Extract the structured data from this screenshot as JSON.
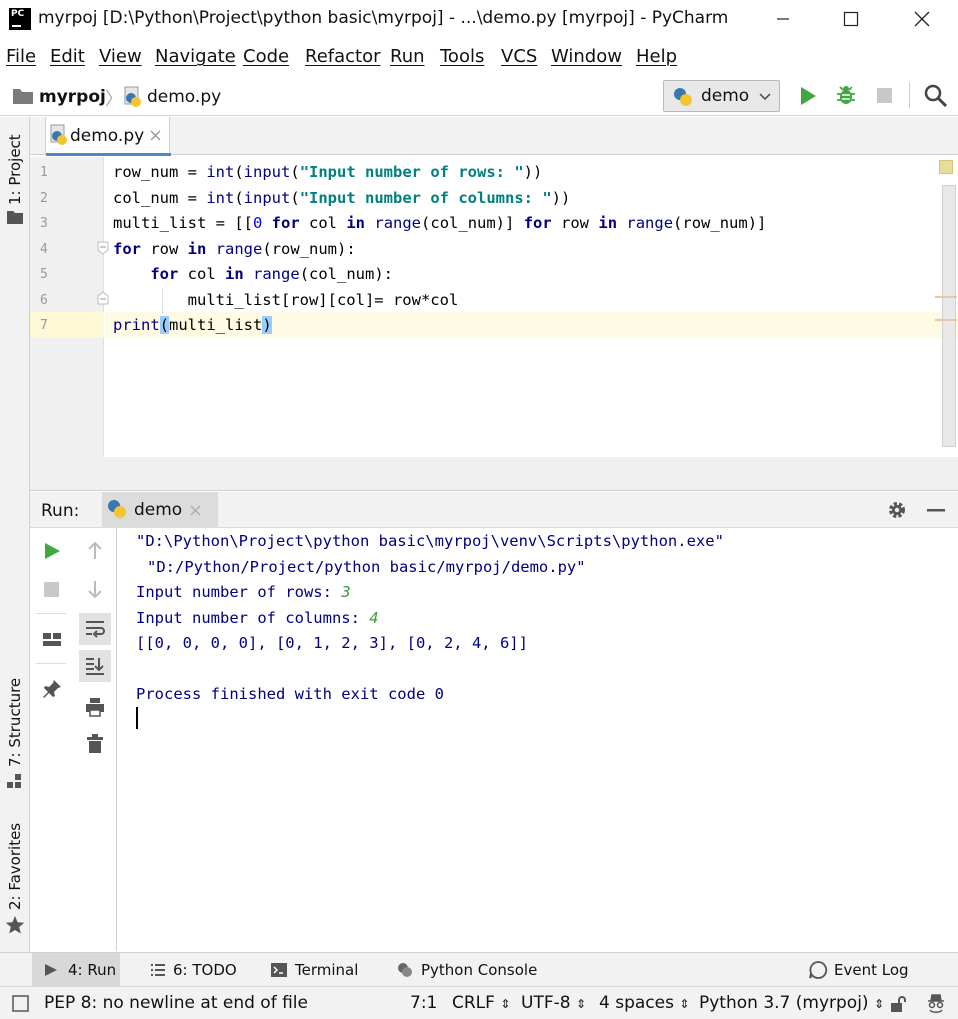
{
  "window": {
    "title": "myrpoj [D:\\Python\\Project\\python basic\\myrpoj] - ...\\demo.py [myrpoj] - PyCharm",
    "app_icon_text": "PC"
  },
  "menu": [
    "File",
    "Edit",
    "View",
    "Navigate",
    "Code",
    "Refactor",
    "Run",
    "Tools",
    "VCS",
    "Window",
    "Help"
  ],
  "navbar": {
    "project": "myrpoj",
    "file": "demo.py",
    "run_config": "demo"
  },
  "editor_tab": {
    "label": "demo.py"
  },
  "side_tools": {
    "project": "1: Project",
    "structure": "7: Structure",
    "favorites": "2: Favorites"
  },
  "editor": {
    "line_numbers": [
      "1",
      "2",
      "3",
      "4",
      "5",
      "6",
      "7"
    ]
  },
  "run_panel": {
    "label": "Run:",
    "tab": "demo",
    "console": {
      "cmd_line1": "\"D:\\Python\\Project\\python basic\\myrpoj\\venv\\Scripts\\python.exe\"",
      "cmd_line2": "\"D:/Python/Project/python basic/myrpoj/demo.py\"",
      "prompt_rows": "Input number of rows: ",
      "rows_value": "3",
      "prompt_cols": "Input number of columns: ",
      "cols_value": "4",
      "result": "[[0, 0, 0, 0], [0, 1, 2, 3], [0, 2, 4, 6]]",
      "finished": "Process finished with exit code 0"
    }
  },
  "bottom_tabs": {
    "run": "4: Run",
    "todo": "6: TODO",
    "terminal": "Terminal",
    "python_console": "Python Console",
    "event_log": "Event Log"
  },
  "status": {
    "message": "PEP 8: no newline at end of file",
    "position": "7:1",
    "line_sep": "CRLF",
    "encoding": "UTF-8",
    "indent": "4 spaces",
    "interpreter": "Python 3.7 (myrpoj)"
  },
  "colors": {
    "run_green": "#3fa83f",
    "accent_blue": "#4a88c7",
    "keyword": "#000080",
    "string": "#008080"
  }
}
